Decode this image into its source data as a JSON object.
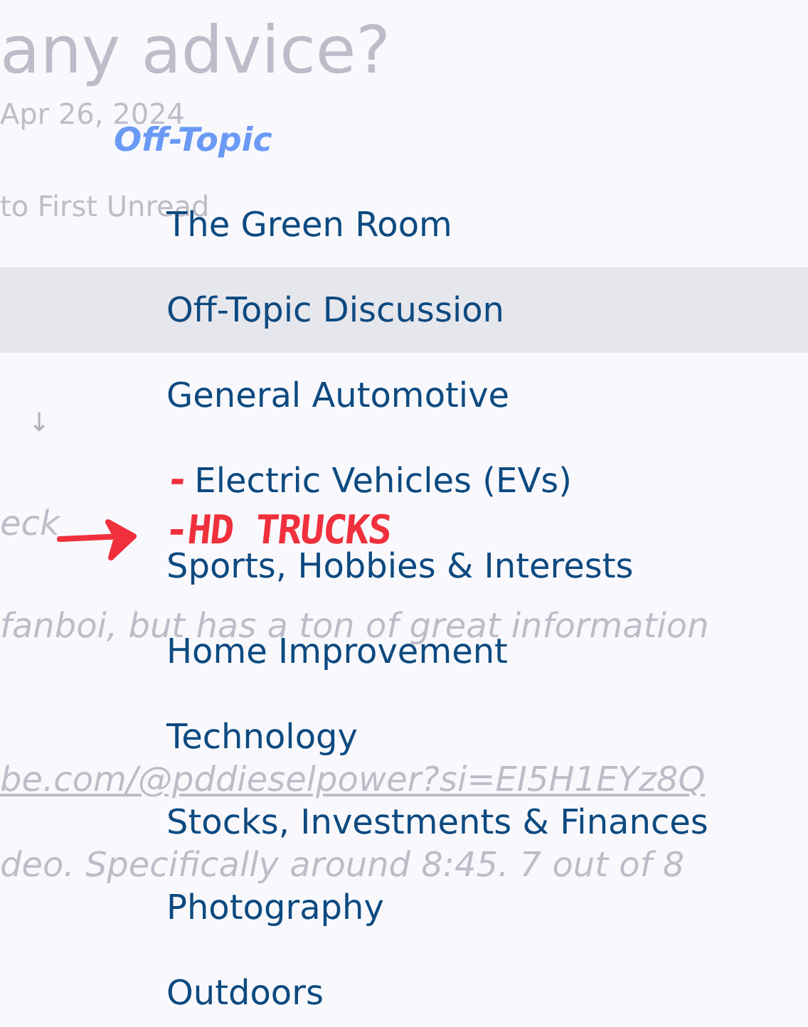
{
  "background": [
    {
      "kind": "title",
      "text": "any advice?"
    },
    {
      "kind": "meta",
      "text": "Apr 26, 2024"
    },
    {
      "kind": "meta",
      "text": "to First Unread"
    },
    {
      "kind": "symbol",
      "text": "↓"
    },
    {
      "kind": "body",
      "text": "eck"
    },
    {
      "kind": "body",
      "text": "fanboi, but has a ton of great information"
    },
    {
      "kind": "link",
      "text": "be.com/@pddieselpower?si=EI5H1EYz8Q"
    },
    {
      "kind": "body",
      "text": "deo. Specifically around 8:45. 7 out of 8"
    }
  ],
  "menu": {
    "heading": "Off-Topic",
    "items": [
      {
        "label": "The Green Room",
        "selected": false
      },
      {
        "label": "Off-Topic Discussion",
        "selected": true
      },
      {
        "label": "General Automotive",
        "selected": false
      },
      {
        "label": "Electric Vehicles (EVs)",
        "selected": false,
        "note_prefix": "-",
        "note_below": "-HD TRUCKS"
      },
      {
        "label": "Sports, Hobbies & Interests",
        "selected": false
      },
      {
        "label": "Home Improvement",
        "selected": false
      },
      {
        "label": "Technology",
        "selected": false
      },
      {
        "label": "Stocks, Investments & Finances",
        "selected": false
      },
      {
        "label": "Photography",
        "selected": false
      },
      {
        "label": "Outdoors",
        "selected": false
      }
    ]
  }
}
